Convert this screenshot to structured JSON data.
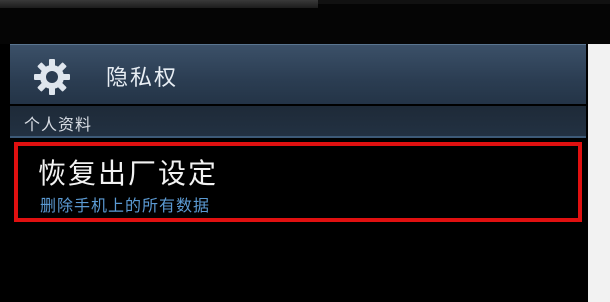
{
  "header": {
    "title": "隐私权",
    "icon": "gear-icon"
  },
  "section": {
    "label": "个人资料"
  },
  "reset_item": {
    "title": "恢复出厂设定",
    "subtitle": "删除手机上的所有数据",
    "highlight_color": "#e01010"
  },
  "colors": {
    "header_bg": "#2b3d52",
    "subtitle_blue": "#5b9ad3",
    "background": "#000000"
  }
}
